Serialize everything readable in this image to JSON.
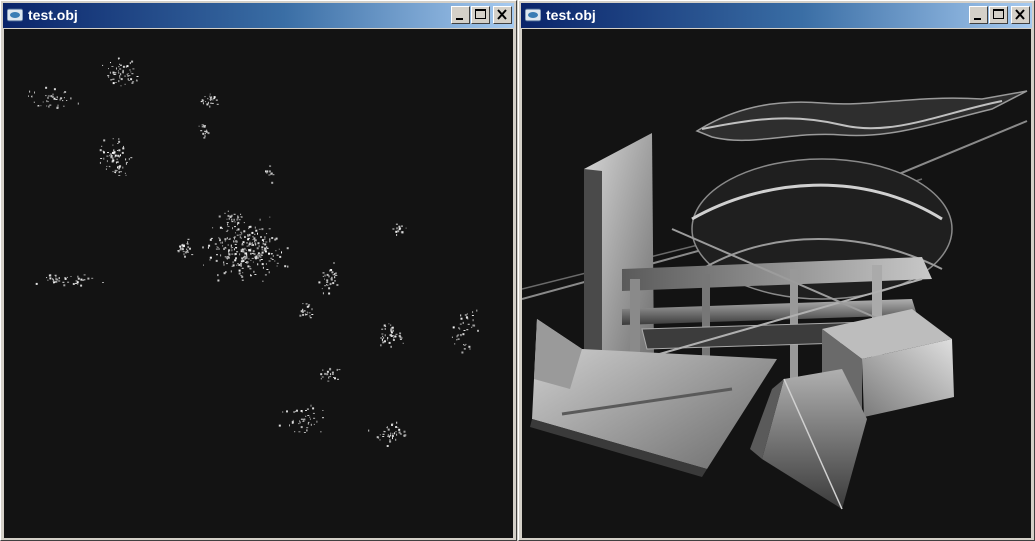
{
  "windows": [
    {
      "title": "test.obj",
      "icon": "app-window-icon",
      "buttons": [
        "minimize-icon",
        "maximize-icon",
        "close-icon"
      ],
      "view": "point-cloud-render"
    },
    {
      "title": "test.obj",
      "icon": "app-window-icon",
      "buttons": [
        "minimize-icon",
        "maximize-icon",
        "close-icon"
      ],
      "view": "shaded-solid-render"
    }
  ],
  "colors": {
    "titlebar_start": "#0a246a",
    "titlebar_end": "#a6caf0",
    "viewport_bg": "#131313",
    "chrome": "#d4d0c8"
  }
}
